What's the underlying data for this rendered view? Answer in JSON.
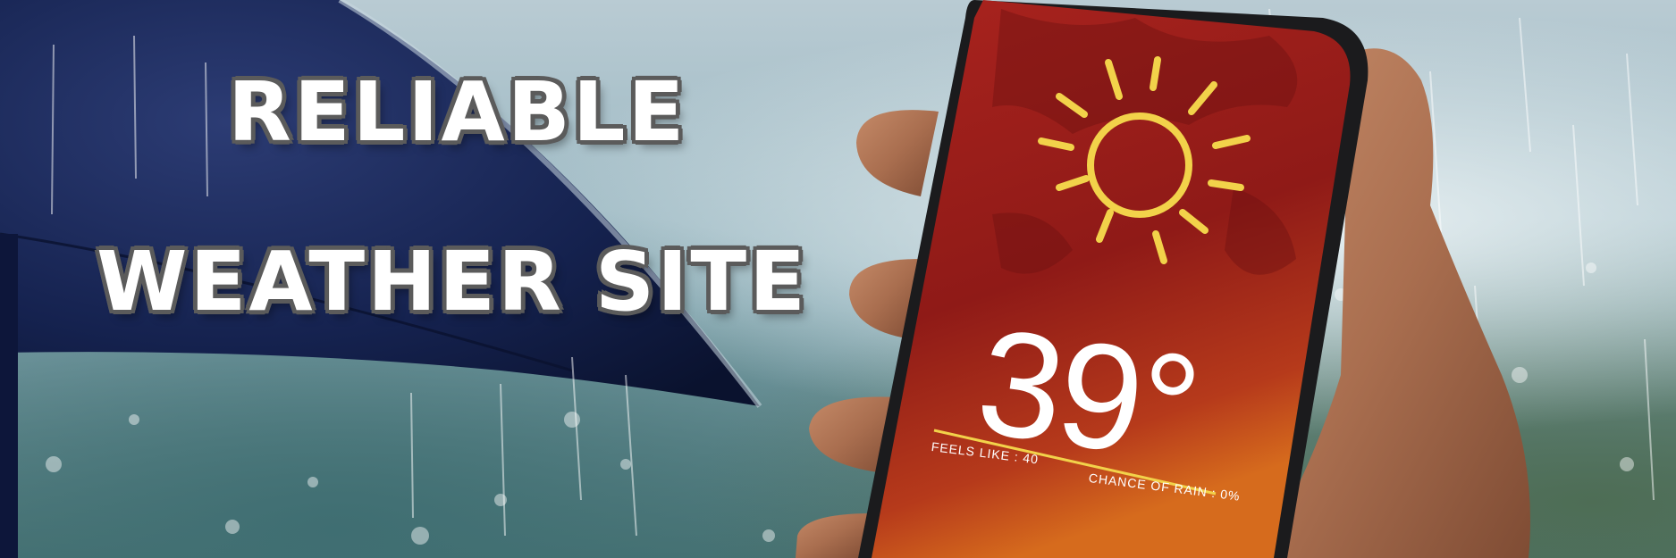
{
  "headline": {
    "line1": "RELIABLE",
    "line2": "WEATHER SITE"
  },
  "weather_app": {
    "temperature": "39°",
    "feels_like": "FEELS LIKE : 40",
    "chance_of_rain": "CHANCE OF RAIN : 0%",
    "icon": "sun-icon"
  },
  "colors": {
    "screen_red": "#a3231c",
    "sun_yellow": "#f2d24a",
    "text_outline": "#5b5b5b"
  }
}
